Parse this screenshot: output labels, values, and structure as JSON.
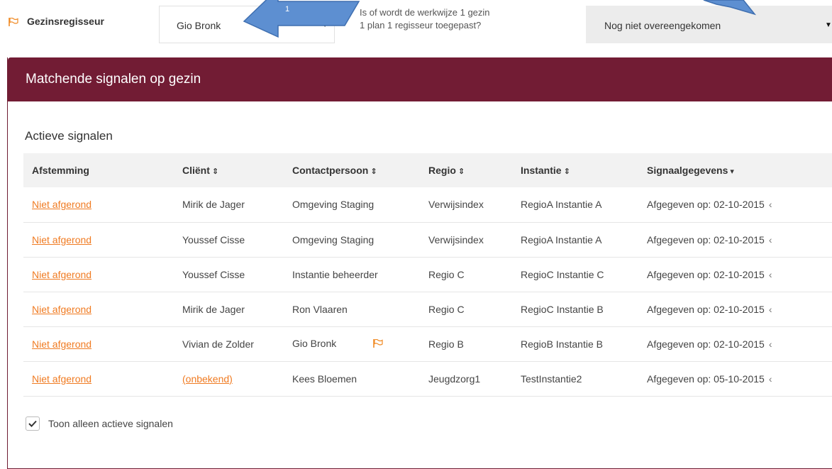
{
  "header": {
    "regisseur_label": "Gezinsregisseur",
    "regisseur_value": "Gio Bronk",
    "question_line1": "Is of wordt de werkwijze 1 gezin",
    "question_line2": "1 plan 1 regisseur toegepast?",
    "status_value": "Nog niet overeengekomen",
    "callout_number": "1"
  },
  "panel": {
    "title": "Matchende signalen op gezin",
    "section_title": "Actieve signalen"
  },
  "table": {
    "columns": [
      "Afstemming",
      "Cliënt",
      "Contactpersoon",
      "Regio",
      "Instantie",
      "Signaalgegevens"
    ],
    "rows": [
      {
        "afstemming": "Niet afgerond",
        "client": "Mirik de Jager",
        "contact": "Omgeving Staging",
        "regio": "Verwijsindex",
        "instantie": "RegioA Instantie A",
        "signaal": "Afgegeven op: 02-10-2015"
      },
      {
        "afstemming": "Niet afgerond",
        "client": "Youssef Cisse",
        "contact": "Omgeving Staging",
        "regio": "Verwijsindex",
        "instantie": "RegioA Instantie A",
        "signaal": "Afgegeven op: 02-10-2015"
      },
      {
        "afstemming": "Niet afgerond",
        "client": "Youssef Cisse",
        "contact": "Instantie beheerder",
        "regio": "Regio C",
        "instantie": "RegioC Instantie C",
        "signaal": "Afgegeven op: 02-10-2015"
      },
      {
        "afstemming": "Niet afgerond",
        "client": "Mirik de Jager",
        "contact": "Ron Vlaaren",
        "regio": "Regio C",
        "instantie": "RegioC Instantie B",
        "signaal": "Afgegeven op: 02-10-2015"
      },
      {
        "afstemming": "Niet afgerond",
        "client": "Vivian de Zolder",
        "contact": "Gio Bronk",
        "regio": "Regio B",
        "instantie": "RegioB Instantie B",
        "signaal": "Afgegeven op: 02-10-2015"
      },
      {
        "afstemming": "Niet afgerond",
        "client": "(onbekend)",
        "contact": "Kees Bloemen",
        "regio": "Jeugdzorg1",
        "instantie": "TestInstantie2",
        "signaal": "Afgegeven op: 05-10-2015"
      }
    ]
  },
  "toggle": {
    "label": "Toon alleen actieve signalen",
    "checked": true
  },
  "colors": {
    "header_bg": "#721c34",
    "link": "#f07b22",
    "flag": "#f08a24",
    "callout": "#5d8fd1"
  }
}
